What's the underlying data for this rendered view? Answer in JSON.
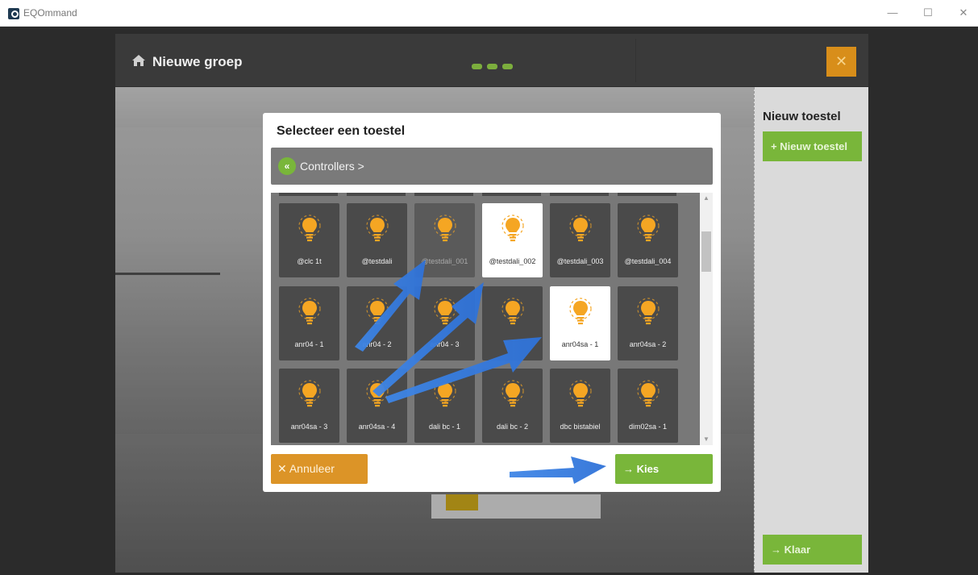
{
  "window": {
    "title": "EQOmmand",
    "minimize": "—",
    "maximize": "☐",
    "close": "✕"
  },
  "header": {
    "title": "Nieuwe groep",
    "close_glyph": "✕"
  },
  "right_panel": {
    "title": "Nieuw toestel",
    "new_button": "+ Nieuw toestel",
    "done_button": "→ Klaar"
  },
  "modal": {
    "title": "Selecteer een toestel",
    "breadcrumb": {
      "back_glyph": "«",
      "label": "Controllers >"
    },
    "devices": [
      {
        "label": "@clc 1t",
        "state": "normal"
      },
      {
        "label": "@testdali",
        "state": "normal"
      },
      {
        "label": "@testdali_001",
        "state": "dimmed"
      },
      {
        "label": "@testdali_002",
        "state": "selected"
      },
      {
        "label": "@testdali_003",
        "state": "normal"
      },
      {
        "label": "@testdali_004",
        "state": "normal"
      },
      {
        "label": "anr04 - 1",
        "state": "normal"
      },
      {
        "label": "anr04 - 2",
        "state": "normal"
      },
      {
        "label": "anr04 - 3",
        "state": "normal"
      },
      {
        "label": "",
        "state": "normal"
      },
      {
        "label": "anr04sa - 1",
        "state": "selected"
      },
      {
        "label": "anr04sa - 2",
        "state": "normal"
      },
      {
        "label": "anr04sa - 3",
        "state": "normal"
      },
      {
        "label": "anr04sa - 4",
        "state": "normal"
      },
      {
        "label": "dali bc - 1",
        "state": "normal"
      },
      {
        "label": "dali bc - 2",
        "state": "normal"
      },
      {
        "label": "dbc bistabiel",
        "state": "normal"
      },
      {
        "label": "dim02sa - 1",
        "state": "normal"
      }
    ],
    "cancel_button": "✕  Annuleer",
    "choose_button": "→  Kies"
  },
  "colors": {
    "green": "#79b63a",
    "orange": "#dc9427",
    "bulb": "#f5a623"
  }
}
